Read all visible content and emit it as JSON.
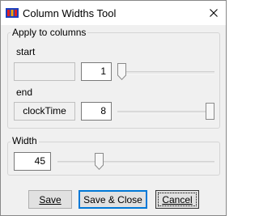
{
  "window": {
    "title": "Column Widths Tool",
    "app_icon": "app-icon",
    "close_icon": "close-icon"
  },
  "apply_group": {
    "label": "Apply to columns",
    "start": {
      "label": "start",
      "name_value": "",
      "number_value": "1",
      "slider_level": 0.0
    },
    "end": {
      "label": "end",
      "name_value": "clockTime",
      "number_value": "8",
      "slider_level": 1.0
    }
  },
  "width_group": {
    "label": "Width",
    "value": "45",
    "slider_level": 0.25
  },
  "buttons": {
    "save": "Save",
    "save_close": "Save & Close",
    "cancel": "Cancel"
  },
  "colors": {
    "accent": "#0078d7",
    "window_bg": "#f0f0f0",
    "icon_blue": "#1b3fbf",
    "icon_red": "#e02020",
    "icon_orange": "#f4a20c"
  }
}
